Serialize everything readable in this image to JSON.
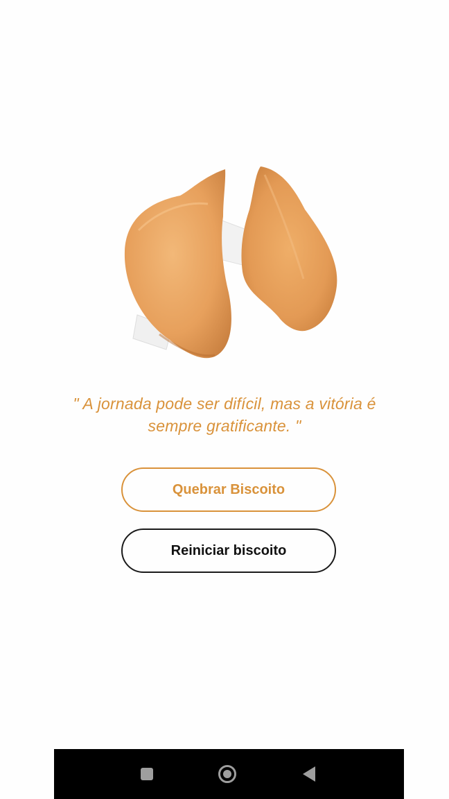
{
  "app": {
    "quote": "\" A jornada pode ser difícil, mas a vitória é sempre gratificante. \"",
    "image": {
      "icon": "fortune-cookie-opened-image"
    },
    "buttons": {
      "break_label": "Quebrar Biscoito",
      "reset_label": "Reiniciar biscoito"
    },
    "colors": {
      "accent": "#d9923a",
      "dark": "#111111",
      "background": "#fefefe"
    }
  },
  "system_nav": {
    "recents_icon": "square-recents-icon",
    "home_icon": "circle-home-icon",
    "back_icon": "triangle-back-icon"
  }
}
